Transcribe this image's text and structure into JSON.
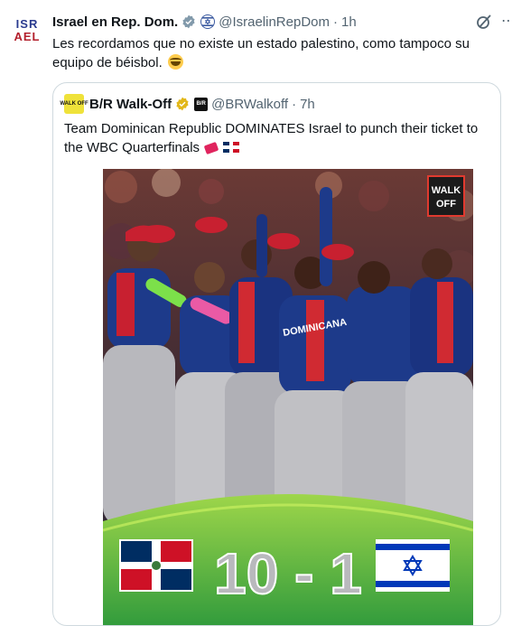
{
  "tweet": {
    "author_name": "Israel en Rep. Dom.",
    "handle": "@IsraelinRepDom",
    "separator": "·",
    "time": "1h",
    "text": "Les recordamos que no existe un estado palestino, como tampoco su equipo de béisbol.",
    "avatar_line1": "ISR",
    "avatar_line2": "AEL",
    "icons": [
      "verified-badge-icon",
      "flag-emoji-icon",
      "grok-icon",
      "more-icon",
      "laughing-emoji-icon"
    ]
  },
  "quote": {
    "author_name": "B/R Walk-Off",
    "badge_text": "B/R",
    "handle": "@BRWalkoff",
    "separator": "·",
    "time": "7h",
    "text": "Team Dominican Republic DOMINATES Israel to punch their ticket to the WBC Quarterfinals",
    "avatar_text": "WALK OFF",
    "image": {
      "logo_text_1": "WALK",
      "logo_text_2": "OFF",
      "score": "10 - 1",
      "jersey_text": "DOMINICANA"
    }
  },
  "colors": {
    "text_primary": "#0f1419",
    "text_secondary": "#536471",
    "border": "#cfd9de",
    "verified_gold": "#e2b719",
    "dr_blue": "#002d62",
    "dr_red": "#ce1126",
    "score_green": "#3fb34a"
  }
}
